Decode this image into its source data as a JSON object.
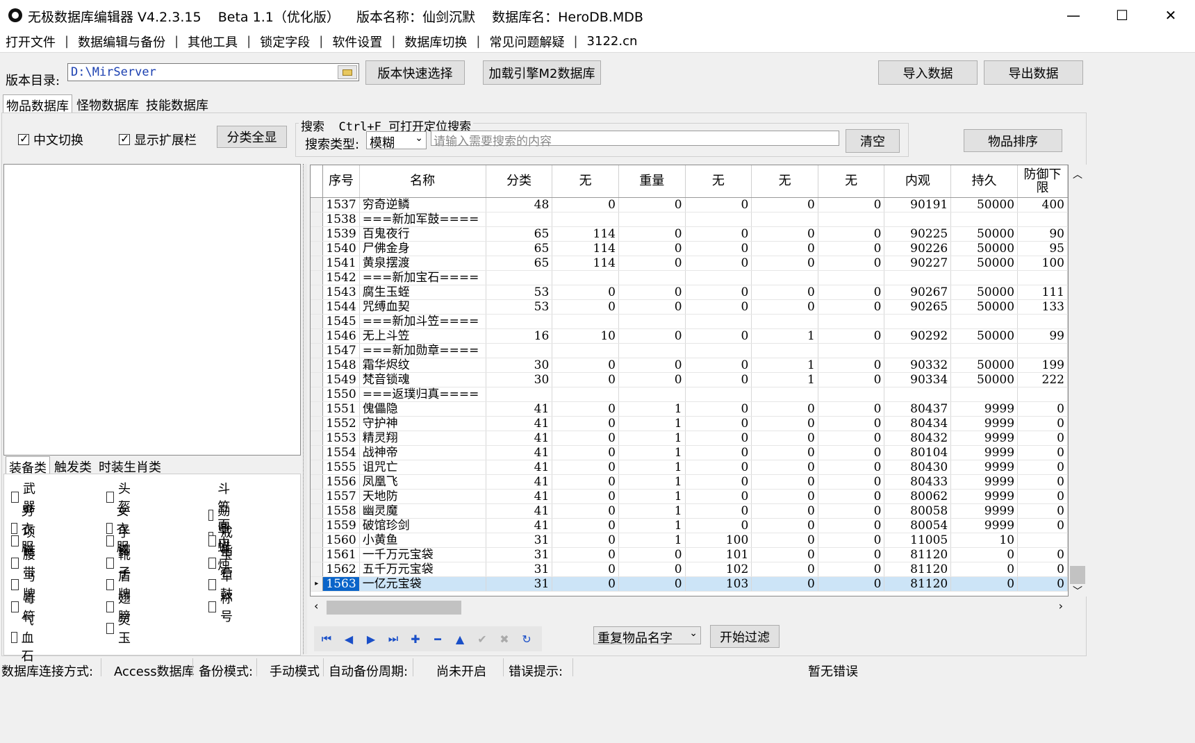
{
  "window": {
    "title": "无极数据库编辑器 V4.2.3.15    Beta 1.1（优化版）    版本名称：仙剑沉默    数据库名：HeroDB.MDB",
    "minimize": "—",
    "maximize": "☐",
    "close": "✕"
  },
  "menu": [
    "打开文件",
    "数据编辑与备份",
    "其他工具",
    "锁定字段",
    "软件设置",
    "数据库切换",
    "常见问题解疑",
    "3122.cn"
  ],
  "toolbar": {
    "dir_label": "版本目录:",
    "dir_value": "D:\\MirServer",
    "quick_select": "版本快速选择",
    "load_m2": "加载引擎M2数据库",
    "import": "导入数据",
    "export": "导出数据"
  },
  "db_tabs": [
    "物品数据库",
    "怪物数据库",
    "技能数据库"
  ],
  "options": {
    "chinese_switch": "中文切换",
    "show_ext": "显示扩展栏",
    "show_all_categories": "分类全显"
  },
  "search": {
    "group_title": "搜索  Ctrl+F 可打开定位搜索",
    "type_label": "搜索类型:",
    "type_value": "模糊",
    "placeholder": "请输入需要搜索的内容",
    "clear": "清空"
  },
  "sort_button": "物品排序",
  "category_tabs": [
    "装备类",
    "触发类",
    "时装生肖类"
  ],
  "categories": [
    [
      "武器",
      "头盔",
      "斗笠面巾"
    ],
    [
      "男衣服",
      "女衣服",
      "勋章蜡烛"
    ],
    [
      "项链",
      "手镯",
      "戒指"
    ],
    [
      "腰带",
      "靴子",
      "宝石"
    ],
    [
      "马牌",
      "盾牌",
      "军鼓"
    ],
    [
      "毒符",
      "翅膀",
      "称号"
    ],
    [
      "气血石",
      "灵玉"
    ]
  ],
  "grid": {
    "columns": [
      "序号",
      "名称",
      "分类",
      "无",
      "重量",
      "无",
      "无",
      "无",
      "内观",
      "持久",
      "防御下限"
    ],
    "rows": [
      [
        "1537",
        "穷奇逆鳞",
        "48",
        "0",
        "0",
        "0",
        "0",
        "0",
        "90191",
        "50000",
        "400"
      ],
      [
        "1538",
        "===新加军鼓====",
        "",
        "",
        "",
        "",
        "",
        "",
        "",
        "",
        ""
      ],
      [
        "1539",
        "百鬼夜行",
        "65",
        "114",
        "0",
        "0",
        "0",
        "0",
        "90225",
        "50000",
        "90"
      ],
      [
        "1540",
        "尸佛金身",
        "65",
        "114",
        "0",
        "0",
        "0",
        "0",
        "90226",
        "50000",
        "95"
      ],
      [
        "1541",
        "黄泉摆渡",
        "65",
        "114",
        "0",
        "0",
        "0",
        "0",
        "90227",
        "50000",
        "100"
      ],
      [
        "1542",
        "===新加宝石====",
        "",
        "",
        "",
        "",
        "",
        "",
        "",
        "",
        ""
      ],
      [
        "1543",
        "腐生玉蛭",
        "53",
        "0",
        "0",
        "0",
        "0",
        "0",
        "90267",
        "50000",
        "111"
      ],
      [
        "1544",
        "咒缚血契",
        "53",
        "0",
        "0",
        "0",
        "0",
        "0",
        "90265",
        "50000",
        "133"
      ],
      [
        "1545",
        "===新加斗笠====",
        "",
        "",
        "",
        "",
        "",
        "",
        "",
        "",
        ""
      ],
      [
        "1546",
        "无上斗笠",
        "16",
        "10",
        "0",
        "0",
        "1",
        "0",
        "90292",
        "50000",
        "99"
      ],
      [
        "1547",
        "===新加勋章====",
        "",
        "",
        "",
        "",
        "",
        "",
        "",
        "",
        ""
      ],
      [
        "1548",
        "霜华烬纹",
        "30",
        "0",
        "0",
        "0",
        "1",
        "0",
        "90332",
        "50000",
        "199"
      ],
      [
        "1549",
        "梵音锁魂",
        "30",
        "0",
        "0",
        "0",
        "1",
        "0",
        "90334",
        "50000",
        "222"
      ],
      [
        "1550",
        "===返璞归真====",
        "",
        "",
        "",
        "",
        "",
        "",
        "",
        "",
        ""
      ],
      [
        "1551",
        "傀儡隐",
        "41",
        "0",
        "1",
        "0",
        "0",
        "0",
        "80437",
        "9999",
        "0"
      ],
      [
        "1552",
        "守护神",
        "41",
        "0",
        "1",
        "0",
        "0",
        "0",
        "80434",
        "9999",
        "0"
      ],
      [
        "1553",
        "精灵翔",
        "41",
        "0",
        "1",
        "0",
        "0",
        "0",
        "80432",
        "9999",
        "0"
      ],
      [
        "1554",
        "战神帝",
        "41",
        "0",
        "1",
        "0",
        "0",
        "0",
        "80104",
        "9999",
        "0"
      ],
      [
        "1555",
        "诅咒亡",
        "41",
        "0",
        "1",
        "0",
        "0",
        "0",
        "80430",
        "9999",
        "0"
      ],
      [
        "1556",
        "凤凰飞",
        "41",
        "0",
        "1",
        "0",
        "0",
        "0",
        "80433",
        "9999",
        "0"
      ],
      [
        "1557",
        "天地防",
        "41",
        "0",
        "1",
        "0",
        "0",
        "0",
        "80062",
        "9999",
        "0"
      ],
      [
        "1558",
        "幽灵魔",
        "41",
        "0",
        "1",
        "0",
        "0",
        "0",
        "80058",
        "9999",
        "0"
      ],
      [
        "1559",
        "破馆珍剑",
        "41",
        "0",
        "1",
        "0",
        "0",
        "0",
        "80054",
        "9999",
        "0"
      ],
      [
        "1560",
        "小黄鱼",
        "31",
        "0",
        "1",
        "100",
        "0",
        "0",
        "11005",
        "10",
        ""
      ],
      [
        "1561",
        "一千万元宝袋",
        "31",
        "0",
        "0",
        "101",
        "0",
        "0",
        "81120",
        "0",
        "0"
      ],
      [
        "1562",
        "五千万元宝袋",
        "31",
        "0",
        "0",
        "102",
        "0",
        "0",
        "81120",
        "0",
        "0"
      ],
      [
        "1563",
        "一亿元宝袋",
        "31",
        "0",
        "0",
        "103",
        "0",
        "0",
        "81120",
        "0",
        "0"
      ]
    ],
    "selected_index": 26
  },
  "filter": {
    "select_value": "重复物品名字",
    "start": "开始过滤"
  },
  "status": {
    "conn_label": "数据库连接方式:",
    "conn_value": "Access数据库",
    "backup_label": "备份模式:",
    "backup_value": "手动模式",
    "auto_label": "自动备份周期:",
    "auto_value": "尚未开启",
    "error_label": "错误提示:",
    "error_value": "暂无错误"
  }
}
